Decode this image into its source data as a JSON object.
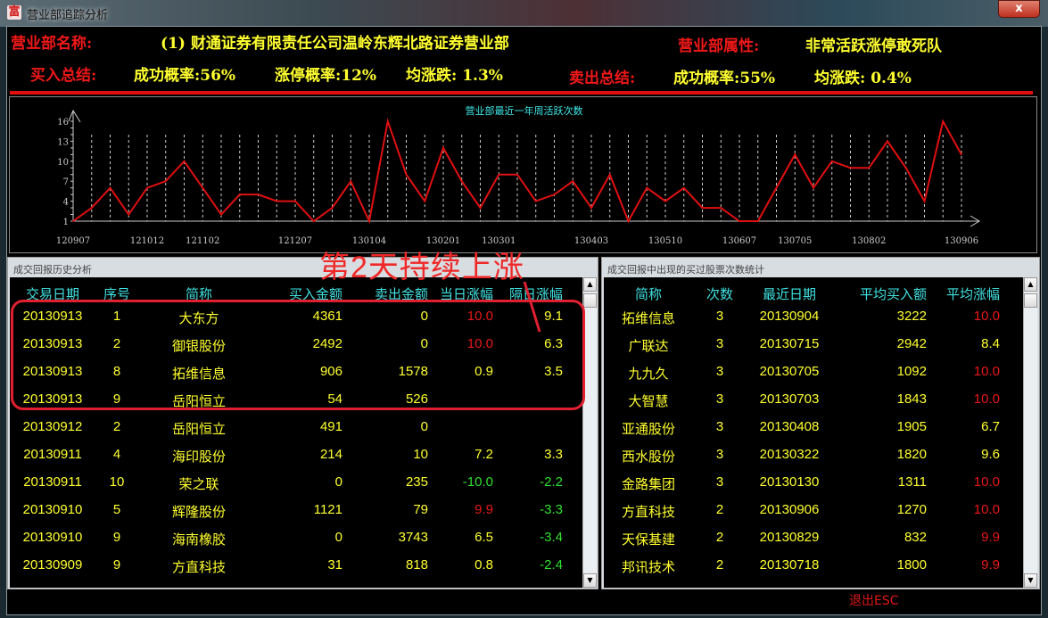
{
  "window": {
    "title": "营业部追踪分析",
    "app_icon": "富",
    "close_label": "x"
  },
  "header": {
    "name_label": "营业部名称:",
    "name_value": "(1) 财通证券有限责任公司温岭东辉北路证券营业部",
    "attr_label": "营业部属性:",
    "attr_value": "非常活跃涨停敢死队",
    "buy_label": "买入总结:",
    "buy_success": "成功概率:56%",
    "buy_limitup": "涨停概率:12%",
    "buy_avg": "均涨跌: 1.3%",
    "sell_label": "卖出总结:",
    "sell_success": "成功概率:55%",
    "sell_avg": "均涨跌: 0.4%"
  },
  "chart_data": {
    "type": "line",
    "title": "营业部最近一年周活跃次数",
    "yticks": [
      1,
      4,
      7,
      10,
      13,
      16
    ],
    "ylim": [
      1,
      16
    ],
    "values": [
      1,
      3,
      6,
      2,
      6,
      7,
      10,
      6,
      2,
      5,
      5,
      4,
      4,
      1,
      3,
      7,
      1,
      16,
      8,
      4,
      12,
      7,
      3,
      8,
      8,
      4,
      5,
      7,
      3,
      8,
      1,
      6,
      4,
      6,
      3,
      3,
      1,
      1,
      6,
      11,
      6,
      10,
      9,
      9,
      13,
      9,
      4,
      16,
      11
    ],
    "xticks": [
      {
        "i": 0,
        "label": "120907"
      },
      {
        "i": 4,
        "label": "121012"
      },
      {
        "i": 7,
        "label": "121102"
      },
      {
        "i": 12,
        "label": "121207"
      },
      {
        "i": 16,
        "label": "130104"
      },
      {
        "i": 20,
        "label": "130201"
      },
      {
        "i": 23,
        "label": "130301"
      },
      {
        "i": 28,
        "label": "130403"
      },
      {
        "i": 32,
        "label": "130510"
      },
      {
        "i": 36,
        "label": "130607"
      },
      {
        "i": 39,
        "label": "130705"
      },
      {
        "i": 43,
        "label": "130802"
      },
      {
        "i": 48,
        "label": "130906"
      }
    ],
    "line_color": "#e01010",
    "grid": "vertical dashed"
  },
  "left_panel": {
    "title": "成交回报历史分析",
    "columns": [
      "交易日期",
      "序号",
      "简称",
      "买入金额",
      "卖出金额",
      "当日涨幅",
      "隔日涨幅"
    ],
    "rows": [
      [
        "20130913",
        "1",
        "大东方",
        "4361",
        "0",
        "10.0",
        "9.1"
      ],
      [
        "20130913",
        "2",
        "御银股份",
        "2492",
        "0",
        "10.0",
        "6.3"
      ],
      [
        "20130913",
        "8",
        "拓维信息",
        "906",
        "1578",
        "0.9",
        "3.5"
      ],
      [
        "20130913",
        "9",
        "岳阳恒立",
        "54",
        "526",
        "",
        ""
      ],
      [
        "20130912",
        "2",
        "岳阳恒立",
        "491",
        "0",
        "",
        ""
      ],
      [
        "20130911",
        "4",
        "海印股份",
        "214",
        "10",
        "7.2",
        "3.3"
      ],
      [
        "20130911",
        "10",
        "荣之联",
        "0",
        "235",
        "-10.0",
        "-2.2"
      ],
      [
        "20130910",
        "5",
        "辉隆股份",
        "1121",
        "79",
        "9.9",
        "-3.3"
      ],
      [
        "20130910",
        "9",
        "海南橡胶",
        "0",
        "3743",
        "6.5",
        "-3.4"
      ],
      [
        "20130909",
        "9",
        "方直科技",
        "31",
        "818",
        "0.8",
        "-2.4"
      ]
    ]
  },
  "right_panel": {
    "title": "成交回报中出现的买过股票次数统计",
    "columns": [
      "简称",
      "次数",
      "最近日期",
      "平均买入额",
      "平均涨幅"
    ],
    "rows": [
      [
        "拓维信息",
        "3",
        "20130904",
        "3222",
        "10.0"
      ],
      [
        "广联达",
        "3",
        "20130715",
        "2942",
        "8.4"
      ],
      [
        "九九久",
        "3",
        "20130705",
        "1092",
        "10.0"
      ],
      [
        "大智慧",
        "3",
        "20130703",
        "1843",
        "10.0"
      ],
      [
        "亚通股份",
        "3",
        "20130408",
        "1905",
        "6.7"
      ],
      [
        "西水股份",
        "3",
        "20130322",
        "1820",
        "9.6"
      ],
      [
        "金路集团",
        "3",
        "20130130",
        "1311",
        "10.0"
      ],
      [
        "方直科技",
        "2",
        "20130906",
        "1270",
        "10.0"
      ],
      [
        "天保基建",
        "2",
        "20130829",
        "832",
        "9.9"
      ],
      [
        "邦讯技术",
        "2",
        "20130718",
        "1800",
        "9.9"
      ]
    ]
  },
  "annotation": {
    "text": "第2天持续上涨",
    "color": "#e02030"
  },
  "footer": {
    "exit_label": "退出ESC"
  },
  "colors": {
    "up": "#e81818",
    "down": "#30e030",
    "text": "#ffff30",
    "header": "#40e0e0"
  }
}
